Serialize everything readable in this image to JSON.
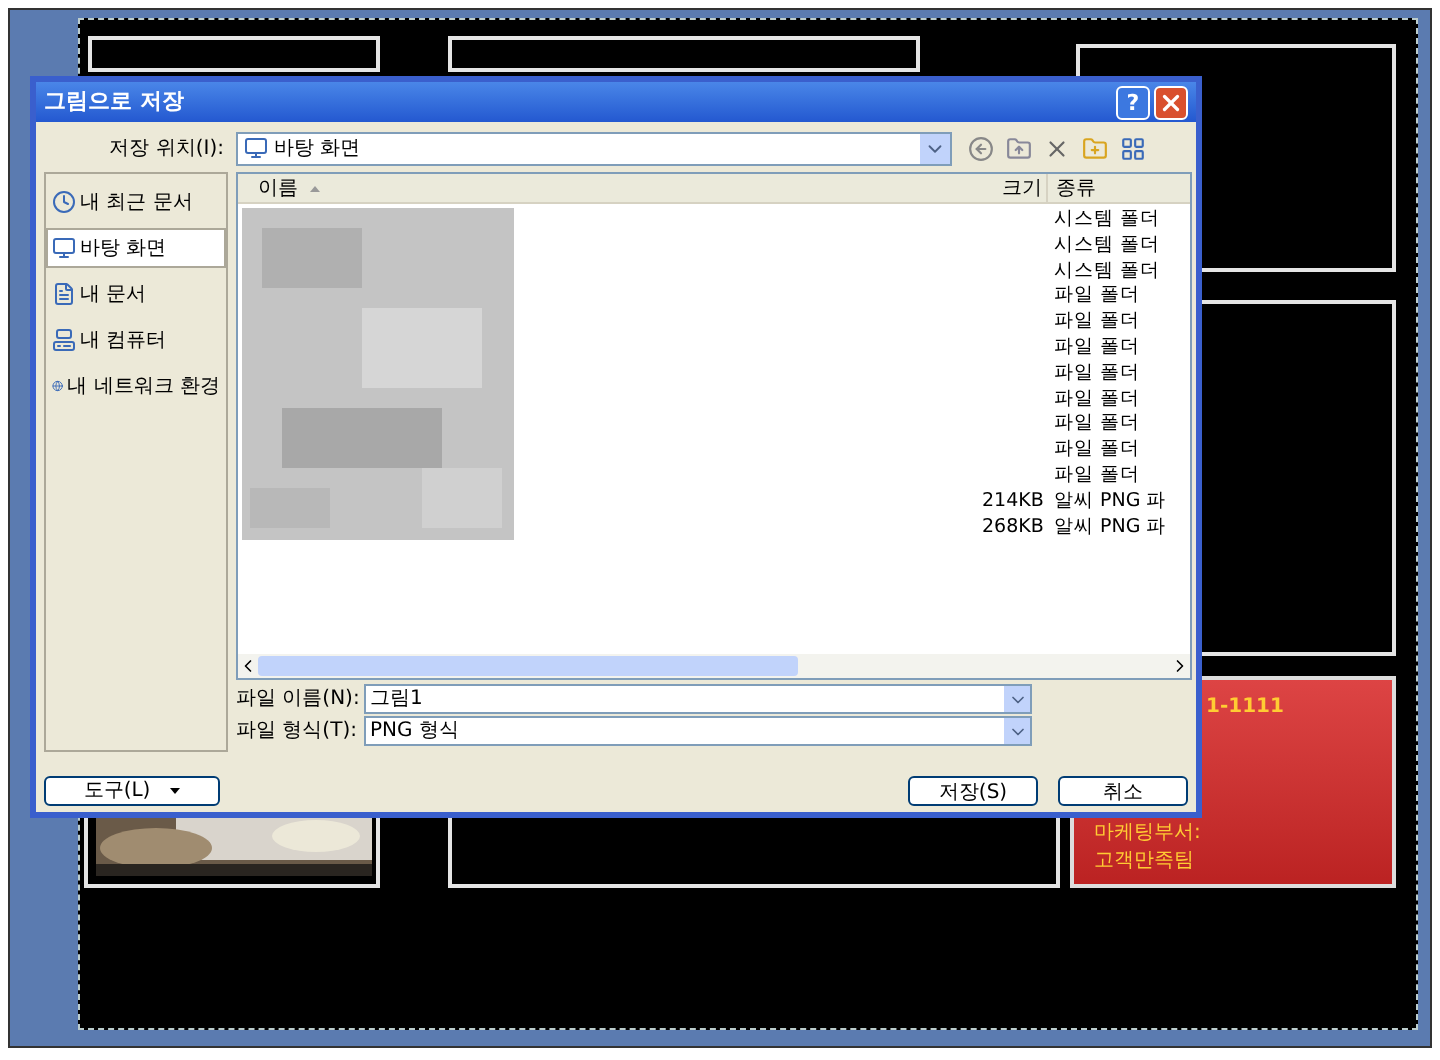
{
  "dialog": {
    "title": "그림으로 저장",
    "help_button": "?",
    "save_in": {
      "label": "저장 위치(I):",
      "value": "바탕 화면"
    },
    "places": [
      {
        "label": "내 최근 문서",
        "selected": false
      },
      {
        "label": "바탕 화면",
        "selected": true
      },
      {
        "label": "내 문서",
        "selected": false
      },
      {
        "label": "내 컴퓨터",
        "selected": false
      },
      {
        "label": "내 네트워크 환경",
        "selected": false
      }
    ],
    "file_list": {
      "columns": [
        "이름",
        "크기",
        "종류"
      ],
      "rows": [
        {
          "type": "시스템 폴더"
        },
        {
          "type": "시스템 폴더"
        },
        {
          "type": "시스템 폴더"
        },
        {
          "type": "파일 폴더"
        },
        {
          "type": "파일 폴더"
        },
        {
          "type": "파일 폴더"
        },
        {
          "type": "파일 폴더"
        },
        {
          "type": "파일 폴더"
        },
        {
          "type": "파일 폴더"
        },
        {
          "type": "파일 폴더"
        },
        {
          "type": "파일 폴더"
        },
        {
          "size": "214KB",
          "type": "알씨 PNG 파"
        },
        {
          "size": "268KB",
          "type": "알씨 PNG 파"
        }
      ]
    },
    "file_name": {
      "label": "파일 이름(N):",
      "value": "그림1"
    },
    "file_type": {
      "label": "파일 형식(T):",
      "value": "PNG 형식"
    },
    "tools_button": "도구(L)",
    "save_button": "저장(S)",
    "cancel_button": "취소"
  },
  "slide": {
    "red_box_lines": [
      "1-1111",
      "마케팅부서:",
      "고객만족팀"
    ]
  }
}
